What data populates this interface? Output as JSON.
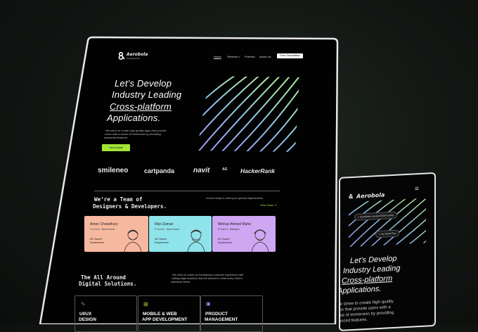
{
  "desktop": {
    "logo_text": "Aerobola",
    "logo_sub": "Top Rated Plus",
    "nav": {
      "home": "Home",
      "services": "Services",
      "portfolio": "Portfolio",
      "about": "About Us",
      "cta": "Free Consultation"
    },
    "hero": {
      "line1": "Let’s Develop",
      "line2": "Industry Leading",
      "line3": "Cross-platform",
      "line4": "Applications.",
      "desc1": "We strive to create high quality apps that provide",
      "desc2": "users with a sense of immersion by providing",
      "desc3": "advanced features.",
      "cta": "Get A Quote"
    },
    "logos": [
      "smileneo",
      "cartpanda",
      "navit",
      "AG",
      "HackerRank"
    ],
    "team": {
      "title1": "We’re a Team of",
      "title2": "Designers & Developers.",
      "sub": "A team ready to meet your special requirements.",
      "link": "View Team",
      "members": [
        {
          "name": "Amon Chowdhury",
          "role": "Flutter Developer",
          "years": "05 Years+",
          "years_label": "Experience",
          "color": "#f7b8a0"
        },
        {
          "name": "Rijvi Zaman",
          "role": "Flutter Developer",
          "years": "05 Years+",
          "years_label": "Experience",
          "color": "#8fe3ea"
        },
        {
          "name": "Minhaz Ahmed Muhe",
          "role": "Product Manager",
          "years": "05 Years+",
          "years_label": "Experience",
          "color": "#cfa6f2"
        }
      ]
    },
    "services": {
      "title1": "The All Around",
      "title2": "Digital Solutions.",
      "desc1": "We strive to create an exceptional customer experience with",
      "desc2": "cutting-edge solutions that are tailored to meet every client’s",
      "desc3": "individual needs.",
      "items": [
        {
          "l1": "UI/UX",
          "l2": "DESIGN",
          "icon": "pen-icon"
        },
        {
          "l1": "MOBILE & WEB",
          "l2": "APP DEVELOPMENT",
          "icon": "grid-icon"
        },
        {
          "l1": "PRODUCT",
          "l2": "MANAGEMENT",
          "icon": "chart-icon"
        }
      ]
    }
  },
  "mobile": {
    "logo_text": "Aerobola",
    "badge1": "Sometimes received $25k funding",
    "badge2": "Top Rated Plus",
    "hero": {
      "line1": "Let’s Develop",
      "line2": "Industry Leading",
      "line3": "Cross-platform",
      "line4": "Applications.",
      "desc1": "We strive to create high quality",
      "desc2": "apps that provide users with a",
      "desc3": "sense of immersion by providing",
      "desc4": "advanced features."
    }
  },
  "colors": {
    "accent": "#a3e635",
    "background": "#000000",
    "frame": "#e8e8e8"
  }
}
